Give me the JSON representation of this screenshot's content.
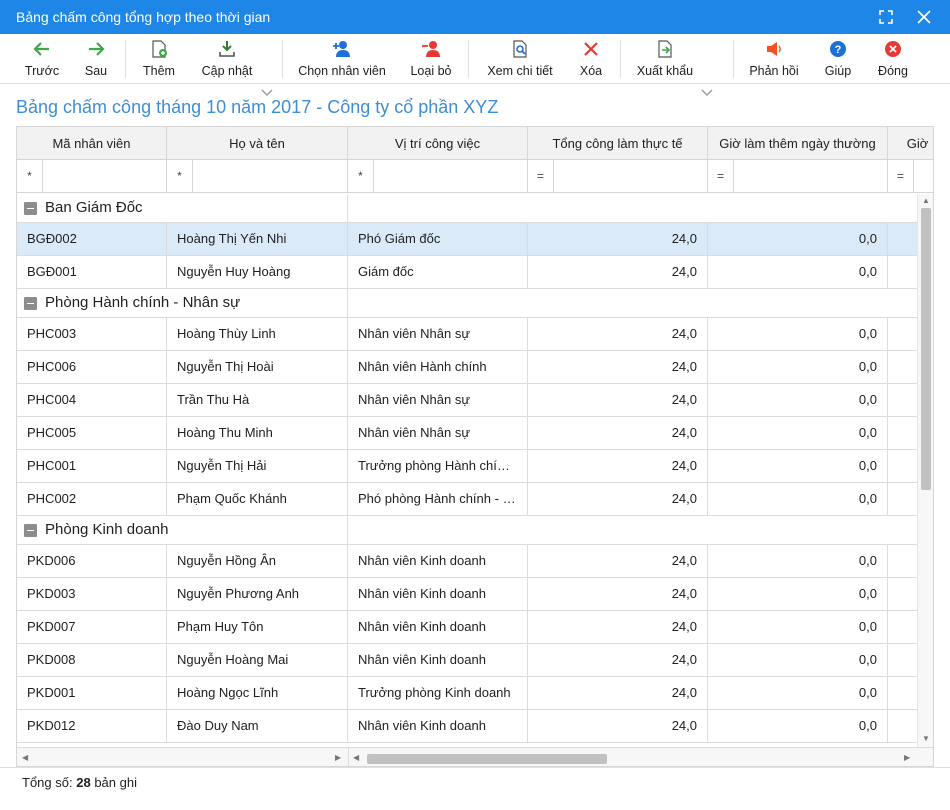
{
  "window": {
    "title": "Bảng chấm công tổng hợp theo thời gian"
  },
  "toolbar": {
    "back": "Trước",
    "next": "Sau",
    "add": "Thêm",
    "update": "Cập nhật",
    "choose_employee": "Chọn nhân viên",
    "remove": "Loại bỏ",
    "view_detail": "Xem chi tiết",
    "delete": "Xóa",
    "export": "Xuất khẩu",
    "feedback": "Phản hồi",
    "help": "Giúp",
    "close": "Đóng"
  },
  "report": {
    "title": "Bảng chấm công tháng 10 năm 2017 - Công ty cổ phần XYZ"
  },
  "grid": {
    "columns": [
      "Mã nhân viên",
      "Họ và tên",
      "Vị trí công việc",
      "Tổng công làm thực tế",
      "Giờ làm thêm ngày thường",
      "Giờ"
    ],
    "filters": [
      "*",
      "*",
      "*",
      "=",
      "=",
      "="
    ],
    "groups": [
      {
        "name": "Ban Giám Đốc",
        "rows": [
          {
            "code": "BGĐ002",
            "name": "Hoàng Thị Yến Nhi",
            "position": "Phó Giám đốc",
            "total": "24,0",
            "overtime": "0,0"
          },
          {
            "code": "BGĐ001",
            "name": "Nguyễn Huy Hoàng",
            "position": "Giám đốc",
            "total": "24,0",
            "overtime": "0,0"
          }
        ]
      },
      {
        "name": "Phòng Hành chính - Nhân sự",
        "rows": [
          {
            "code": "PHC003",
            "name": "Hoàng Thùy Linh",
            "position": "Nhân viên Nhân sự",
            "total": "24,0",
            "overtime": "0,0"
          },
          {
            "code": "PHC006",
            "name": "Nguyễn Thị Hoài",
            "position": "Nhân viên Hành chính",
            "total": "24,0",
            "overtime": "0,0"
          },
          {
            "code": "PHC004",
            "name": "Trần Thu Hà",
            "position": "Nhân viên Nhân sự",
            "total": "24,0",
            "overtime": "0,0"
          },
          {
            "code": "PHC005",
            "name": "Hoàng Thu Minh",
            "position": "Nhân viên Nhân sự",
            "total": "24,0",
            "overtime": "0,0"
          },
          {
            "code": "PHC001",
            "name": "Nguyễn Thị Hải",
            "position": "Trưởng phòng Hành chính…",
            "total": "24,0",
            "overtime": "0,0"
          },
          {
            "code": "PHC002",
            "name": "Phạm Quốc Khánh",
            "position": "Phó phòng Hành chính - N…",
            "total": "24,0",
            "overtime": "0,0"
          }
        ]
      },
      {
        "name": "Phòng Kinh doanh",
        "rows": [
          {
            "code": "PKD006",
            "name": "Nguyễn Hồng Ân",
            "position": "Nhân viên Kinh doanh",
            "total": "24,0",
            "overtime": "0,0"
          },
          {
            "code": "PKD003",
            "name": "Nguyễn Phương Anh",
            "position": "Nhân viên Kinh doanh",
            "total": "24,0",
            "overtime": "0,0"
          },
          {
            "code": "PKD007",
            "name": "Phạm Huy Tôn",
            "position": "Nhân viên Kinh doanh",
            "total": "24,0",
            "overtime": "0,0"
          },
          {
            "code": "PKD008",
            "name": "Nguyễn Hoàng Mai",
            "position": "Nhân viên Kinh doanh",
            "total": "24,0",
            "overtime": "0,0"
          },
          {
            "code": "PKD001",
            "name": "Hoàng Ngọc Lĩnh",
            "position": "Trưởng phòng Kinh doanh",
            "total": "24,0",
            "overtime": "0,0"
          },
          {
            "code": "PKD012",
            "name": "Đào Duy Nam",
            "position": "Nhân viên Kinh doanh",
            "total": "24,0",
            "overtime": "0,0"
          }
        ]
      }
    ]
  },
  "footer": {
    "label": "Tổng số:",
    "count": "28",
    "unit": "bản ghi"
  },
  "colors": {
    "titlebar": "#1e86e6",
    "report_title": "#3d8ed6",
    "selected_row": "#dbeaf9",
    "green_icon": "#3fa84a",
    "red_icon": "#e53935"
  }
}
